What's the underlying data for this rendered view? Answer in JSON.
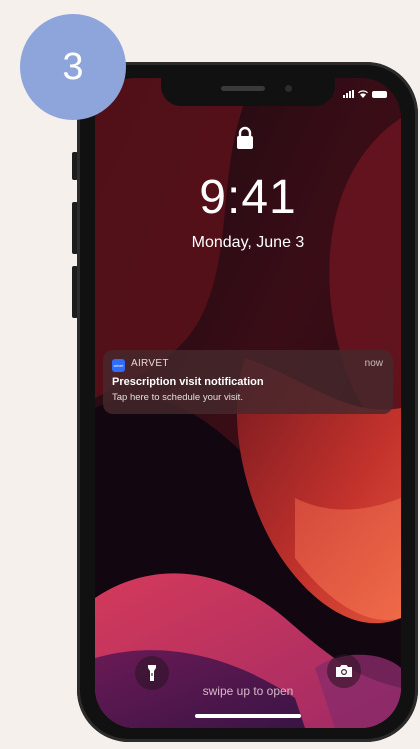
{
  "step_badge": {
    "number": "3",
    "color": "#8ea5db"
  },
  "status_bar": {
    "icons": [
      "cellular-signal-icon",
      "wifi-icon",
      "battery-icon"
    ]
  },
  "lock_screen": {
    "lock_icon": "lock-icon",
    "time": "9:41",
    "date": "Monday, June 3"
  },
  "notification": {
    "app_icon_text": "airvet",
    "app_name": "AIRVET",
    "time": "now",
    "title": "Prescription visit notification",
    "body": "Tap here to schedule your visit.",
    "accent_color": "#2f6bff"
  },
  "bottom": {
    "flashlight_icon": "flashlight-icon",
    "camera_icon": "camera-icon",
    "swipe_text": "swipe up to open"
  }
}
